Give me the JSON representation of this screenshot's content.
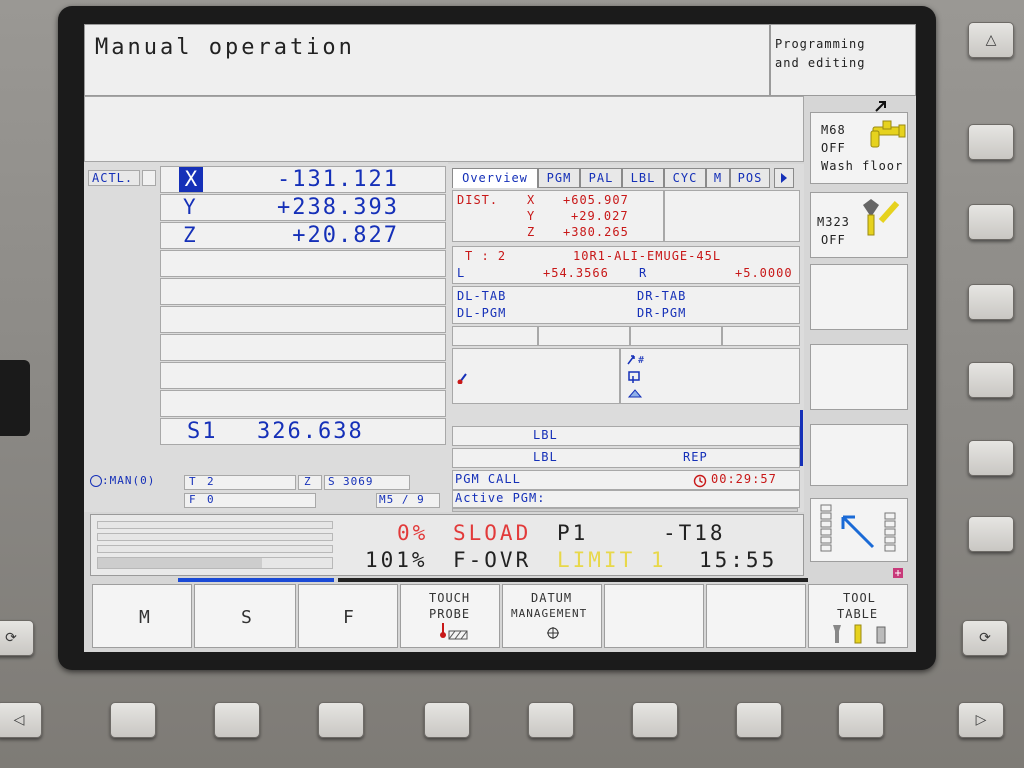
{
  "header": {
    "mode_title": "Manual operation",
    "secondary_mode_line1": "Programming",
    "secondary_mode_line2": "and editing"
  },
  "position": {
    "display_label": "ACTL.",
    "axes": [
      {
        "axis": "X",
        "value": "-131.121",
        "selected": true
      },
      {
        "axis": "Y",
        "value": "+238.393",
        "selected": false
      },
      {
        "axis": "Z",
        "value": "+20.827",
        "selected": false
      }
    ],
    "spindle_label": "S1",
    "spindle_value": "326.638"
  },
  "status_bar": {
    "mode": ":MAN(0)",
    "tool_label": "T",
    "tool_value": "2",
    "axis_label": "Z",
    "speed_label": "S",
    "speed_value": "3069",
    "feed_label": "F",
    "feed_value": "0",
    "m_functions": "M5 / 9"
  },
  "tabs": [
    "Overview",
    "PGM",
    "PAL",
    "LBL",
    "CYC",
    "M",
    "POS"
  ],
  "overview": {
    "dist_label": "DIST.",
    "dist": [
      {
        "axis": "X",
        "value": "+605.907"
      },
      {
        "axis": "Y",
        "value": "+29.027"
      },
      {
        "axis": "Z",
        "value": "+380.265"
      }
    ],
    "tool_number": "T : 2",
    "tool_name": "10R1-ALI-EMUGE-45L",
    "length_label": "L",
    "length_value": "+54.3566",
    "radius_label": "R",
    "radius_value": "+5.0000",
    "dl_tab": "DL-TAB",
    "dr_tab": "DR-TAB",
    "dl_pgm": "DL-PGM",
    "dr_pgm": "DR-PGM",
    "lbl_1": "LBL",
    "lbl_2": "LBL",
    "rep": "REP",
    "pgm_call": "PGM CALL",
    "run_time": "00:29:57",
    "active_pgm": "Active PGM:"
  },
  "machine_status": {
    "load_pct": "0%",
    "sload": "SLOAD",
    "p_label": "P1",
    "tool_ref": "-T18",
    "override_pct": "101%",
    "override_label": "F-OVR",
    "limit_label": "LIMIT 1",
    "clock": "15:55"
  },
  "vertical_softkeys": {
    "m68_line1": "M68",
    "m68_line2": "OFF",
    "m68_line3": "Wash floor",
    "m323_line1": "M323",
    "m323_line2": "OFF"
  },
  "softkeys": {
    "m": "M",
    "s": "S",
    "f": "F",
    "touch_probe_line1": "TOUCH",
    "touch_probe_line2": "PROBE",
    "datum_line1": "DATUM",
    "datum_line2": "MANAGEMENT",
    "tool_table_line1": "TOOL",
    "tool_table_line2": "TABLE"
  },
  "colors": {
    "value_blue": "#1530b8",
    "alert_red": "#c81818",
    "limit_yellow": "#e8d84a",
    "screen_bg": "#d6d6d6"
  }
}
